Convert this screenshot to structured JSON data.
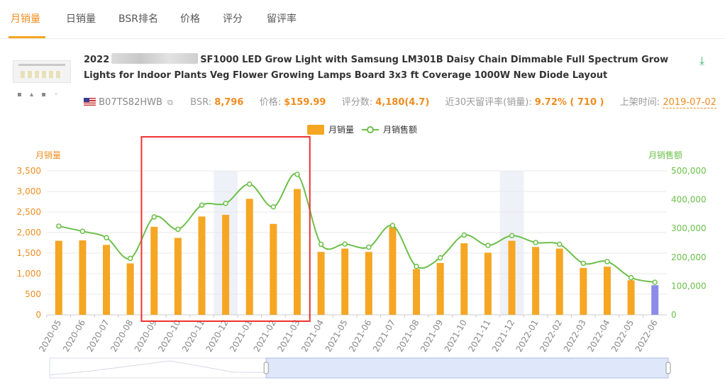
{
  "tabs": [
    {
      "label": "月销量",
      "active": true
    },
    {
      "label": "日销量",
      "active": false
    },
    {
      "label": "BSR排名",
      "active": false
    },
    {
      "label": "价格",
      "active": false
    },
    {
      "label": "评分",
      "active": false
    },
    {
      "label": "留评率",
      "active": false
    }
  ],
  "product": {
    "title_prefix": "2022",
    "title_rest": "SF1000 LED Grow Light with Samsung LM301B Daisy Chain Dimmable Full Spectrum Grow Lights for Indoor Plants Veg Flower Growing Lamps Board 3x3 ft Coverage 1000W New Diode Layout",
    "asin": "B07TS82HWB",
    "bsr_label": "BSR:",
    "bsr_value": "8,796",
    "price_label": "价格:",
    "price_value": "$159.99",
    "rating_label": "评分数:",
    "rating_value": "4,180(4.7)",
    "review_rate_label": "近30天留评率(销量):",
    "review_rate_value": "9.72% ( 710 )",
    "listing_date_label": "上架时间:",
    "listing_date_value": "2019-07-02"
  },
  "colors": {
    "bar": "#f5a623",
    "bar_current": "#8c8ce8",
    "line": "#6cc04a",
    "accent": "#f08c1e",
    "highlight_box": "#e33"
  },
  "chart_data": {
    "type": "bar",
    "legend": [
      {
        "name": "月销量",
        "kind": "bar"
      },
      {
        "name": "月销售额",
        "kind": "line"
      }
    ],
    "legend_position": "top-center",
    "left_axis_label": "月销量",
    "right_axis_label": "月销售额",
    "ylim_left": [
      0,
      3500
    ],
    "yticks_left": [
      "0",
      "500",
      "1,000",
      "1,500",
      "2,000",
      "2,500",
      "3,000",
      "3,500"
    ],
    "ylim_right": [
      0,
      500000
    ],
    "yticks_right": [
      "0",
      "100,000",
      "200,000",
      "300,000",
      "400,000",
      "500,000"
    ],
    "categories": [
      "2020-05",
      "2020-06",
      "2020-07",
      "2020-08",
      "2020-09",
      "2020-10",
      "2020-11",
      "2020-12",
      "2021-01",
      "2021-02",
      "2021-03",
      "2021-04",
      "2021-05",
      "2021-06",
      "2021-07",
      "2021-08",
      "2021-09",
      "2021-10",
      "2021-11",
      "2021-12",
      "2022-01",
      "2022-02",
      "2022-03",
      "2022-04",
      "2022-05",
      "2022-06"
    ],
    "series": [
      {
        "name": "月销量",
        "type": "bar",
        "values": [
          1800,
          1810,
          1700,
          1250,
          2140,
          1870,
          2390,
          2430,
          2820,
          2210,
          3060,
          1530,
          1610,
          1530,
          2140,
          1110,
          1260,
          1740,
          1510,
          1800,
          1650,
          1610,
          1140,
          1170,
          840,
          720
        ]
      },
      {
        "name": "月销售额",
        "type": "line",
        "values": [
          308000,
          290000,
          268000,
          196000,
          340000,
          297000,
          381000,
          387000,
          454000,
          375000,
          488000,
          245000,
          246000,
          235000,
          310000,
          168000,
          198000,
          277000,
          241000,
          275000,
          251000,
          245000,
          179000,
          185000,
          129000,
          113000
        ]
      }
    ],
    "shaded_categories": [
      "2020-12",
      "2021-12"
    ],
    "current_month": "2022-06",
    "highlight_range": [
      "2020-09",
      "2021-03"
    ],
    "grid": true,
    "slider_range": [
      0.35,
      1.0
    ]
  }
}
